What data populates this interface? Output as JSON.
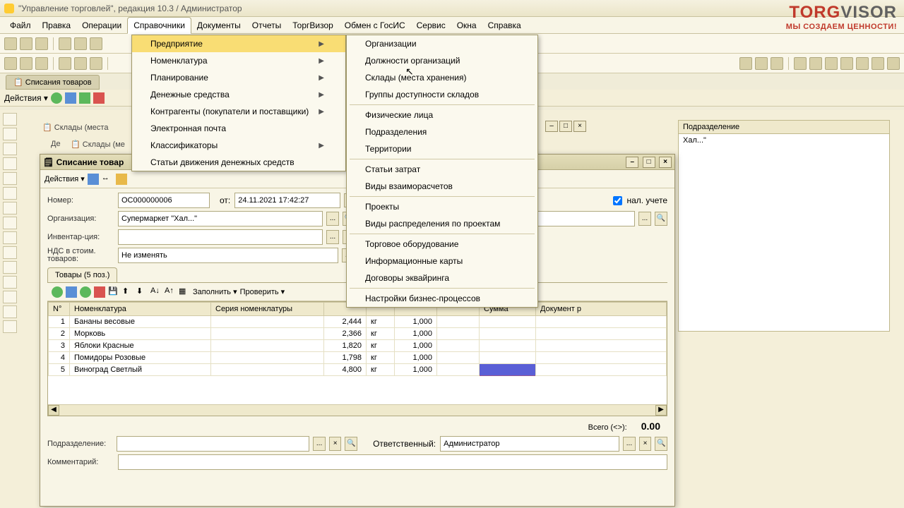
{
  "title": "\"Управление торговлей\", редакция 10.3 / Администратор",
  "menu": {
    "file": "Файл",
    "edit": "Правка",
    "ops": "Операции",
    "refs": "Справочники",
    "docs": "Документы",
    "reports": "Отчеты",
    "tv": "ТоргВизор",
    "gos": "Обмен с ГосИС",
    "svc": "Сервис",
    "win": "Окна",
    "help": "Справка"
  },
  "logo": {
    "line1a": "TORG",
    "line1b": "VISOR",
    "line2": "МЫ СОЗДАЕМ ЦЕННОСТИ!"
  },
  "tabname": "Списания товаров",
  "actions": "Действия",
  "submenu1": [
    {
      "label": "Предприятие",
      "arrow": true,
      "hl": true
    },
    {
      "label": "Номенклатура",
      "arrow": true
    },
    {
      "label": "Планирование",
      "arrow": true
    },
    {
      "label": "Денежные средства",
      "arrow": true
    },
    {
      "label": "Контрагенты (покупатели и поставщики)",
      "arrow": true
    },
    {
      "label": "Электронная почта"
    },
    {
      "label": "Классификаторы",
      "arrow": true
    },
    {
      "label": "Статьи движения денежных средств"
    }
  ],
  "submenu2": [
    {
      "label": "Организации"
    },
    {
      "label": "Должности организаций"
    },
    {
      "label": "Склады (места хранения)"
    },
    {
      "label": "Группы доступности складов"
    },
    {
      "label": "Физические лица"
    },
    {
      "label": "Подразделения"
    },
    {
      "label": "Территории"
    },
    {
      "label": "Статьи затрат"
    },
    {
      "label": "Виды взаиморасчетов"
    },
    {
      "label": "Проекты"
    },
    {
      "label": "Виды распределения по проектам"
    },
    {
      "label": "Торговое оборудование"
    },
    {
      "label": "Информационные карты"
    },
    {
      "label": "Договоры эквайринга"
    },
    {
      "label": "Настройки бизнес-процессов"
    }
  ],
  "dividers2": [
    3,
    6,
    8,
    10,
    13
  ],
  "bgtab1": "Склады (места",
  "bgtab2": "Склады (ме",
  "bgtab3": "Де",
  "doc": {
    "title": "Списание товар",
    "number_lbl": "Номер:",
    "number": "ОС000000006",
    "from": "от:",
    "date": "24.11.2021 17:42:27",
    "org_lbl": "Организация:",
    "org": "Супермаркет \"Хал...\"",
    "inv_lbl": "Инвентар-ция:",
    "nds_lbl": "НДС в стоим. товаров:",
    "nds": "Не изменять",
    "nal": "нал. учете",
    "tabs": {
      "goods": "Товары (5 поз.)"
    },
    "fill": "Заполнить",
    "check": "Проверить",
    "cols": {
      "n": "N°",
      "nomen": "Номенклатура",
      "series": "Серия номенклатуры",
      "unit_k": "",
      "sum": "Сумма",
      "docr": "Документ р"
    },
    "rows": [
      {
        "n": 1,
        "name": "Бананы весовые",
        "w": "2,444",
        "u": "кг",
        "k": "1,000"
      },
      {
        "n": 2,
        "name": "Морковь",
        "w": "2,366",
        "u": "кг",
        "k": "1,000"
      },
      {
        "n": 3,
        "name": "Яблоки Красные",
        "w": "1,820",
        "u": "кг",
        "k": "1,000"
      },
      {
        "n": 4,
        "name": "Помидоры Розовые",
        "w": "1,798",
        "u": "кг",
        "k": "1,000"
      },
      {
        "n": 5,
        "name": "Виноград Светлый",
        "w": "4,800",
        "u": "кг",
        "k": "1,000"
      }
    ],
    "total_lbl": "Всего (<>):",
    "total": "0.00",
    "dept_lbl": "Подразделение:",
    "resp_lbl": "Ответственный:",
    "resp": "Администратор",
    "comment_lbl": "Комментарий:"
  },
  "bg_grid": {
    "h1": "Подразделение",
    "cell": "Хал...\""
  }
}
